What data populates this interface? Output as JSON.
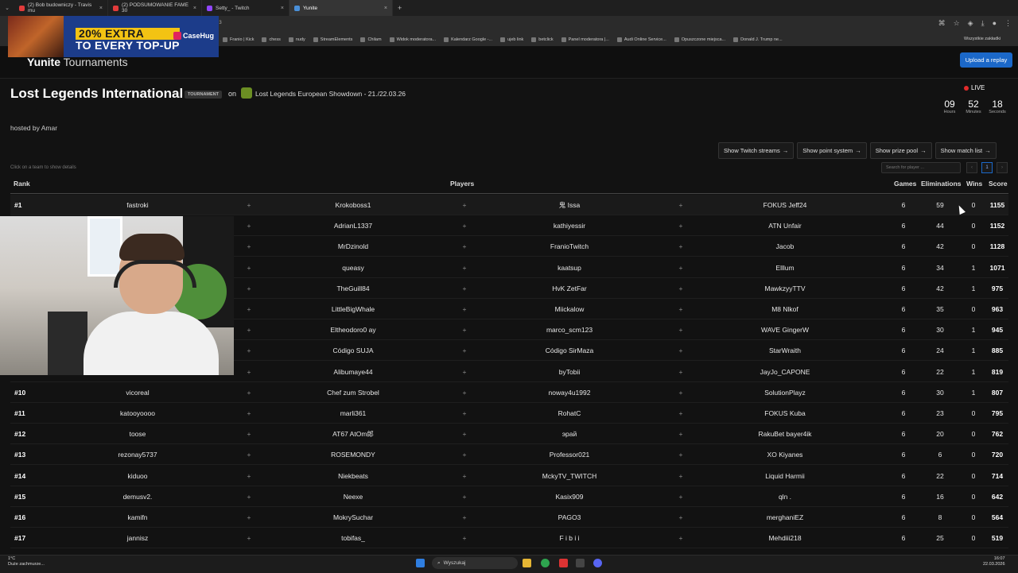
{
  "browser": {
    "tabs": [
      {
        "label": "(2) Bob budowniczy - Travis mu",
        "color": "#e23b3b",
        "active": false
      },
      {
        "label": "(2) PODSUMOWANIE FAME 30",
        "color": "#e23b3b",
        "active": false
      },
      {
        "label": "Setty_ - Twitch",
        "color": "#9146ff",
        "active": false
      },
      {
        "label": "Yunite",
        "color": "#4a90d9",
        "active": true
      }
    ],
    "address_fragment": "23",
    "bookmarks": [
      "Franio | Kick",
      "chess",
      "nudy",
      "StreamElements",
      "Chilam",
      "Widok moderatora...",
      "Kalendarz Google -...",
      "ujeb link",
      "betclick",
      "Panel moderatora |...",
      "Audi Online Service...",
      "Opuszczone miejsca...",
      "Donald J. Trump ne..."
    ],
    "all_bookmarks": "Wszystkie zakładki"
  },
  "ad": {
    "line1": "20% EXTRA",
    "line2": "TO EVERY TOP-UP",
    "brand": "CaseHug"
  },
  "site": {
    "brand_bold": "Yunite",
    "brand_rest": " Tournaments",
    "upload_label": "Upload a replay"
  },
  "tournament": {
    "name": "Lost Legends International",
    "badge": "TOURNAMENT",
    "on": "on",
    "event": "Lost Legends European Showdown - 21./22.03.26",
    "hosted_by": "hosted by Amar",
    "live": "LIVE",
    "countdown": [
      {
        "value": "09",
        "unit": "Hours"
      },
      {
        "value": "52",
        "unit": "Minutes"
      },
      {
        "value": "18",
        "unit": "Seconds"
      }
    ]
  },
  "actions": [
    "Show Twitch streams",
    "Show point system",
    "Show prize pool",
    "Show match list"
  ],
  "hint": "Click on a team to show details",
  "search_placeholder": "Search for player ...",
  "page_current": "1",
  "columns": {
    "rank": "Rank",
    "players": "Players",
    "games": "Games",
    "elims": "Eliminations",
    "wins": "Wins",
    "score": "Score"
  },
  "rows": [
    {
      "rank": "#1",
      "p": [
        "fastroki",
        "Krokoboss1",
        "鬼 Issa",
        "FOKUS Jeff24"
      ],
      "games": "6",
      "elims": "59",
      "wins": "0",
      "score": "1155"
    },
    {
      "rank": "",
      "p": [
        "",
        "AdrianL1337",
        "kathiyessir",
        "ATN Unfair"
      ],
      "games": "6",
      "elims": "44",
      "wins": "0",
      "score": "1152"
    },
    {
      "rank": "",
      "p": [
        "",
        "MrDzinold",
        "FranioTwitch",
        "Jacob"
      ],
      "games": "6",
      "elims": "42",
      "wins": "0",
      "score": "1128"
    },
    {
      "rank": "",
      "p": [
        "",
        "queasy",
        "kaatsup",
        "Elllum"
      ],
      "games": "6",
      "elims": "34",
      "wins": "1",
      "score": "1071"
    },
    {
      "rank": "",
      "p": [
        "",
        "TheGuill84",
        "HvK ZetFar",
        "MawkzyyTTV"
      ],
      "games": "6",
      "elims": "42",
      "wins": "1",
      "score": "975"
    },
    {
      "rank": "",
      "p": [
        "",
        "LittleBigWhale",
        "Miickalow",
        "M8 Nlkof"
      ],
      "games": "6",
      "elims": "35",
      "wins": "0",
      "score": "963"
    },
    {
      "rank": "",
      "p": [
        "",
        "Eltheodoro0 ay",
        "marco_scm123",
        "WAVE GingerW"
      ],
      "games": "6",
      "elims": "30",
      "wins": "1",
      "score": "945"
    },
    {
      "rank": "",
      "p": [
        "",
        "Código SUJA",
        "Código SirMaza",
        "StarWraith"
      ],
      "games": "6",
      "elims": "24",
      "wins": "1",
      "score": "885"
    },
    {
      "rank": "",
      "p": [
        "",
        "Alibumaye44",
        "byTobii",
        "JayJo_CAPONE"
      ],
      "games": "6",
      "elims": "22",
      "wins": "1",
      "score": "819"
    },
    {
      "rank": "#10",
      "p": [
        "vicoreal",
        "Chef zum Strobel",
        "noway4u1992",
        "SolutionPlayz"
      ],
      "games": "6",
      "elims": "30",
      "wins": "1",
      "score": "807"
    },
    {
      "rank": "#11",
      "p": [
        "katooyoooo",
        "marli361",
        "RohatC",
        "FOKUS Kuba"
      ],
      "games": "6",
      "elims": "23",
      "wins": "0",
      "score": "795"
    },
    {
      "rank": "#12",
      "p": [
        "toose",
        "AT67 AtOm郎",
        "эрай",
        "RakuBet bayer4ik"
      ],
      "games": "6",
      "elims": "20",
      "wins": "0",
      "score": "762"
    },
    {
      "rank": "#13",
      "p": [
        "rezonay5737",
        "ROSEMONDY",
        "Professor021",
        "XO Kiyanes"
      ],
      "games": "6",
      "elims": "6",
      "wins": "0",
      "score": "720"
    },
    {
      "rank": "#14",
      "p": [
        "kiduoo",
        "Niekbeats",
        "MckyTV_TWITCH",
        "Liquid Harmii"
      ],
      "games": "6",
      "elims": "22",
      "wins": "0",
      "score": "714"
    },
    {
      "rank": "#15",
      "p": [
        "demusv2.",
        "Neexe",
        "Kasix909",
        "qln ."
      ],
      "games": "6",
      "elims": "16",
      "wins": "0",
      "score": "642"
    },
    {
      "rank": "#16",
      "p": [
        "kamifn",
        "MokrySuchar",
        "PAGO3",
        "merghaniEZ"
      ],
      "games": "6",
      "elims": "8",
      "wins": "0",
      "score": "564"
    },
    {
      "rank": "#17",
      "p": [
        "jannisz",
        "tobifas_",
        "F i b i i",
        "Mehdiii218"
      ],
      "games": "6",
      "elims": "25",
      "wins": "0",
      "score": "519"
    }
  ],
  "taskbar": {
    "temp": "1°C",
    "weather": "Duże zachmurze...",
    "search": "Wyszukaj",
    "time": "16:07",
    "date": "22.03.2026"
  }
}
